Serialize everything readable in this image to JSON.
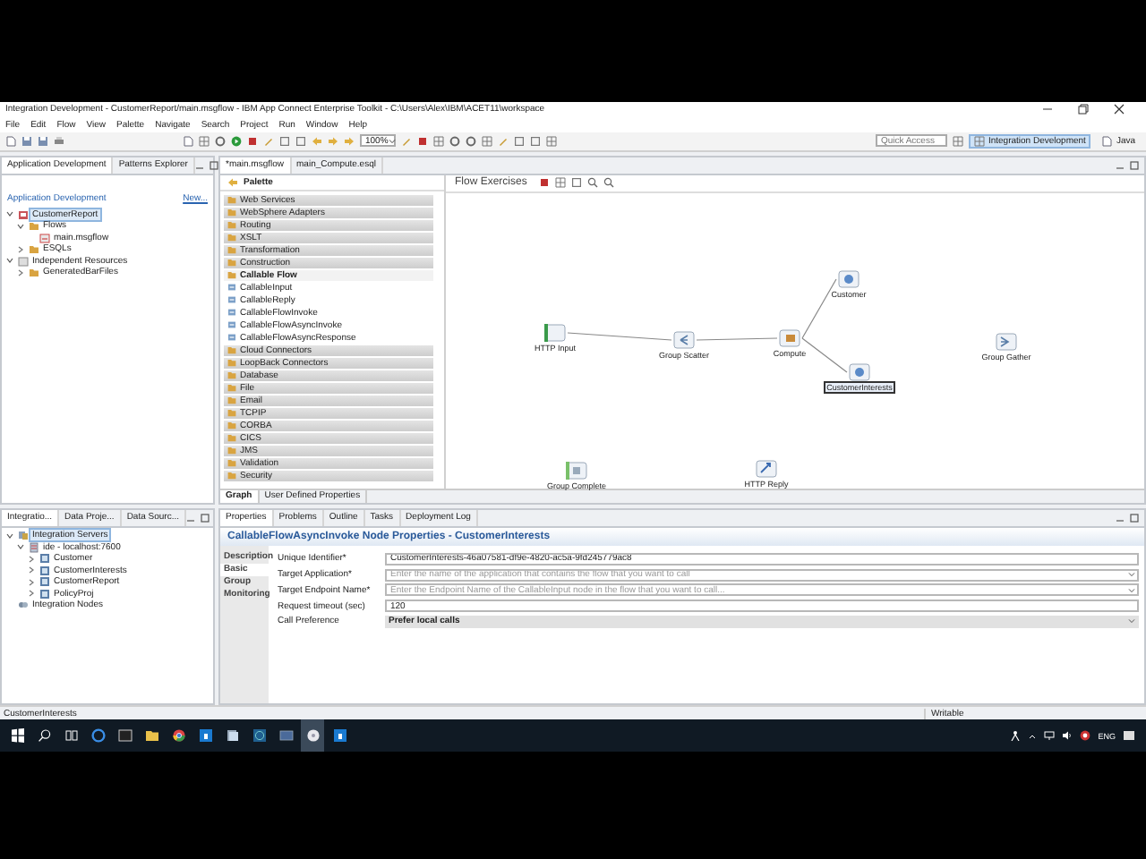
{
  "window": {
    "title": "Integration Development - CustomerReport/main.msgflow - IBM App Connect Enterprise Toolkit - C:\\Users\\Alex\\IBM\\ACET11\\workspace"
  },
  "menu": [
    "File",
    "Edit",
    "Flow",
    "View",
    "Palette",
    "Navigate",
    "Search",
    "Project",
    "Run",
    "Window",
    "Help"
  ],
  "toolbar": {
    "zoom": "100%",
    "quick_access": {
      "placeholder": "Quick Access"
    },
    "perspectives": [
      {
        "label": "Integration Development",
        "selected": true
      },
      {
        "label": "Java",
        "selected": false
      }
    ]
  },
  "explorer": {
    "tabs": [
      {
        "label": "Application Development",
        "selected": true
      },
      {
        "label": "Patterns Explorer",
        "selected": false
      }
    ],
    "heading": "Application Development",
    "new_link": "New...",
    "tree": [
      {
        "label": "CustomerReport",
        "kind": "project",
        "expanded": true,
        "selected": true,
        "children": [
          {
            "label": "Flows",
            "kind": "folder",
            "expanded": true,
            "selected": false,
            "children": [
              {
                "label": "main.msgflow",
                "kind": "flow",
                "selected": false
              }
            ]
          },
          {
            "label": "ESQLs",
            "kind": "folder",
            "expanded": false,
            "selected": false
          }
        ]
      },
      {
        "label": "Independent Resources",
        "kind": "resources",
        "expanded": true,
        "selected": false,
        "children": [
          {
            "label": "GeneratedBarFiles",
            "kind": "folder",
            "expanded": false,
            "selected": false
          }
        ]
      }
    ]
  },
  "editor": {
    "tabs": [
      {
        "label": "*main.msgflow",
        "selected": true
      },
      {
        "label": "main_Compute.esql",
        "selected": false
      }
    ],
    "palette": {
      "title": "Palette",
      "drawers": [
        {
          "label": "Web Services",
          "expanded": false
        },
        {
          "label": "WebSphere Adapters",
          "expanded": false
        },
        {
          "label": "Routing",
          "expanded": false
        },
        {
          "label": "XSLT",
          "expanded": false
        },
        {
          "label": "Transformation",
          "expanded": false
        },
        {
          "label": "Construction",
          "expanded": false
        },
        {
          "label": "Callable Flow",
          "expanded": true,
          "items": [
            "CallableInput",
            "CallableReply",
            "CallableFlowInvoke",
            "CallableFlowAsyncInvoke",
            "CallableFlowAsyncResponse"
          ]
        },
        {
          "label": "Cloud Connectors",
          "expanded": false
        },
        {
          "label": "LoopBack Connectors",
          "expanded": false
        },
        {
          "label": "Database",
          "expanded": false
        },
        {
          "label": "File",
          "expanded": false
        },
        {
          "label": "Email",
          "expanded": false
        },
        {
          "label": "TCPIP",
          "expanded": false
        },
        {
          "label": "CORBA",
          "expanded": false
        },
        {
          "label": "CICS",
          "expanded": false
        },
        {
          "label": "JMS",
          "expanded": false
        },
        {
          "label": "Validation",
          "expanded": false
        },
        {
          "label": "Security",
          "expanded": false
        }
      ]
    },
    "flow": {
      "title": "Flow Exercises",
      "nodes": [
        {
          "label": "HTTP Input",
          "kind": "input",
          "selected": false
        },
        {
          "label": "Group Scatter",
          "kind": "scatter",
          "selected": false
        },
        {
          "label": "Compute",
          "kind": "compute",
          "selected": false
        },
        {
          "label": "Customer",
          "kind": "callable",
          "selected": false
        },
        {
          "label": "CustomerInterests",
          "kind": "callable",
          "selected": true
        },
        {
          "label": "Group Gather",
          "kind": "gather",
          "selected": false
        },
        {
          "label": "Group Complete",
          "kind": "complete",
          "selected": false
        },
        {
          "label": "HTTP Reply",
          "kind": "reply",
          "selected": false
        }
      ]
    },
    "bottom_tabs": [
      {
        "label": "Graph",
        "selected": true
      },
      {
        "label": "User Defined Properties",
        "selected": false
      }
    ]
  },
  "servers": {
    "tabs": [
      {
        "label": "Integratio...",
        "selected": true
      },
      {
        "label": "Data Proje...",
        "selected": false
      },
      {
        "label": "Data Sourc...",
        "selected": false
      }
    ],
    "tree": [
      {
        "label": "Integration Servers",
        "kind": "servers",
        "expanded": true,
        "selected": true,
        "children": [
          {
            "label": "ide - localhost:7600",
            "kind": "server",
            "expanded": true,
            "selected": false,
            "children": [
              {
                "label": "Customer",
                "kind": "app",
                "expanded": false,
                "selected": false
              },
              {
                "label": "CustomerInterests",
                "kind": "app",
                "expanded": false,
                "selected": false
              },
              {
                "label": "CustomerReport",
                "kind": "app",
                "expanded": false,
                "selected": false
              },
              {
                "label": "PolicyProj",
                "kind": "app",
                "expanded": false,
                "selected": false
              }
            ]
          }
        ]
      },
      {
        "label": "Integration Nodes",
        "kind": "nodes",
        "selected": false
      }
    ]
  },
  "properties": {
    "tabs": [
      {
        "label": "Properties",
        "selected": true
      },
      {
        "label": "Problems",
        "selected": false
      },
      {
        "label": "Outline",
        "selected": false
      },
      {
        "label": "Tasks",
        "selected": false
      },
      {
        "label": "Deployment Log",
        "selected": false
      }
    ],
    "title": "CallableFlowAsyncInvoke Node Properties - CustomerInterests",
    "sections": [
      {
        "label": "Description",
        "selected": false
      },
      {
        "label": "Basic",
        "selected": true
      },
      {
        "label": "Group",
        "selected": false
      },
      {
        "label": "Monitoring",
        "selected": false
      }
    ],
    "fields": [
      {
        "label": "Unique Identifier*",
        "kind": "text",
        "value": "CustomerInterests-46a07581-df9e-4820-ac5a-9fd245779ac8"
      },
      {
        "label": "Target Application*",
        "kind": "combo",
        "placeholder": "Enter the name of the application that contains the flow that you want to call"
      },
      {
        "label": "Target Endpoint Name*",
        "kind": "combo",
        "placeholder": "Enter the Endpoint Name of the CallableInput node in the flow that you want to call..."
      },
      {
        "label": "Request timeout (sec)",
        "kind": "text",
        "value": "120"
      },
      {
        "label": "Call Preference",
        "kind": "select",
        "value": "Prefer local calls"
      }
    ]
  },
  "status_bar": {
    "selection": "CustomerInterests",
    "mode": "Writable"
  },
  "taskbar": {
    "apps": [
      {
        "kind": "edge",
        "selected": false
      },
      {
        "kind": "console",
        "selected": false
      },
      {
        "kind": "explorer",
        "selected": false
      },
      {
        "kind": "chrome",
        "selected": false
      },
      {
        "kind": "tile",
        "selected": false
      },
      {
        "kind": "files",
        "selected": false
      },
      {
        "kind": "globe",
        "selected": false
      },
      {
        "kind": "window",
        "selected": false
      },
      {
        "kind": "disc",
        "selected": true
      },
      {
        "kind": "tile",
        "selected": false
      }
    ],
    "language": "ENG"
  }
}
